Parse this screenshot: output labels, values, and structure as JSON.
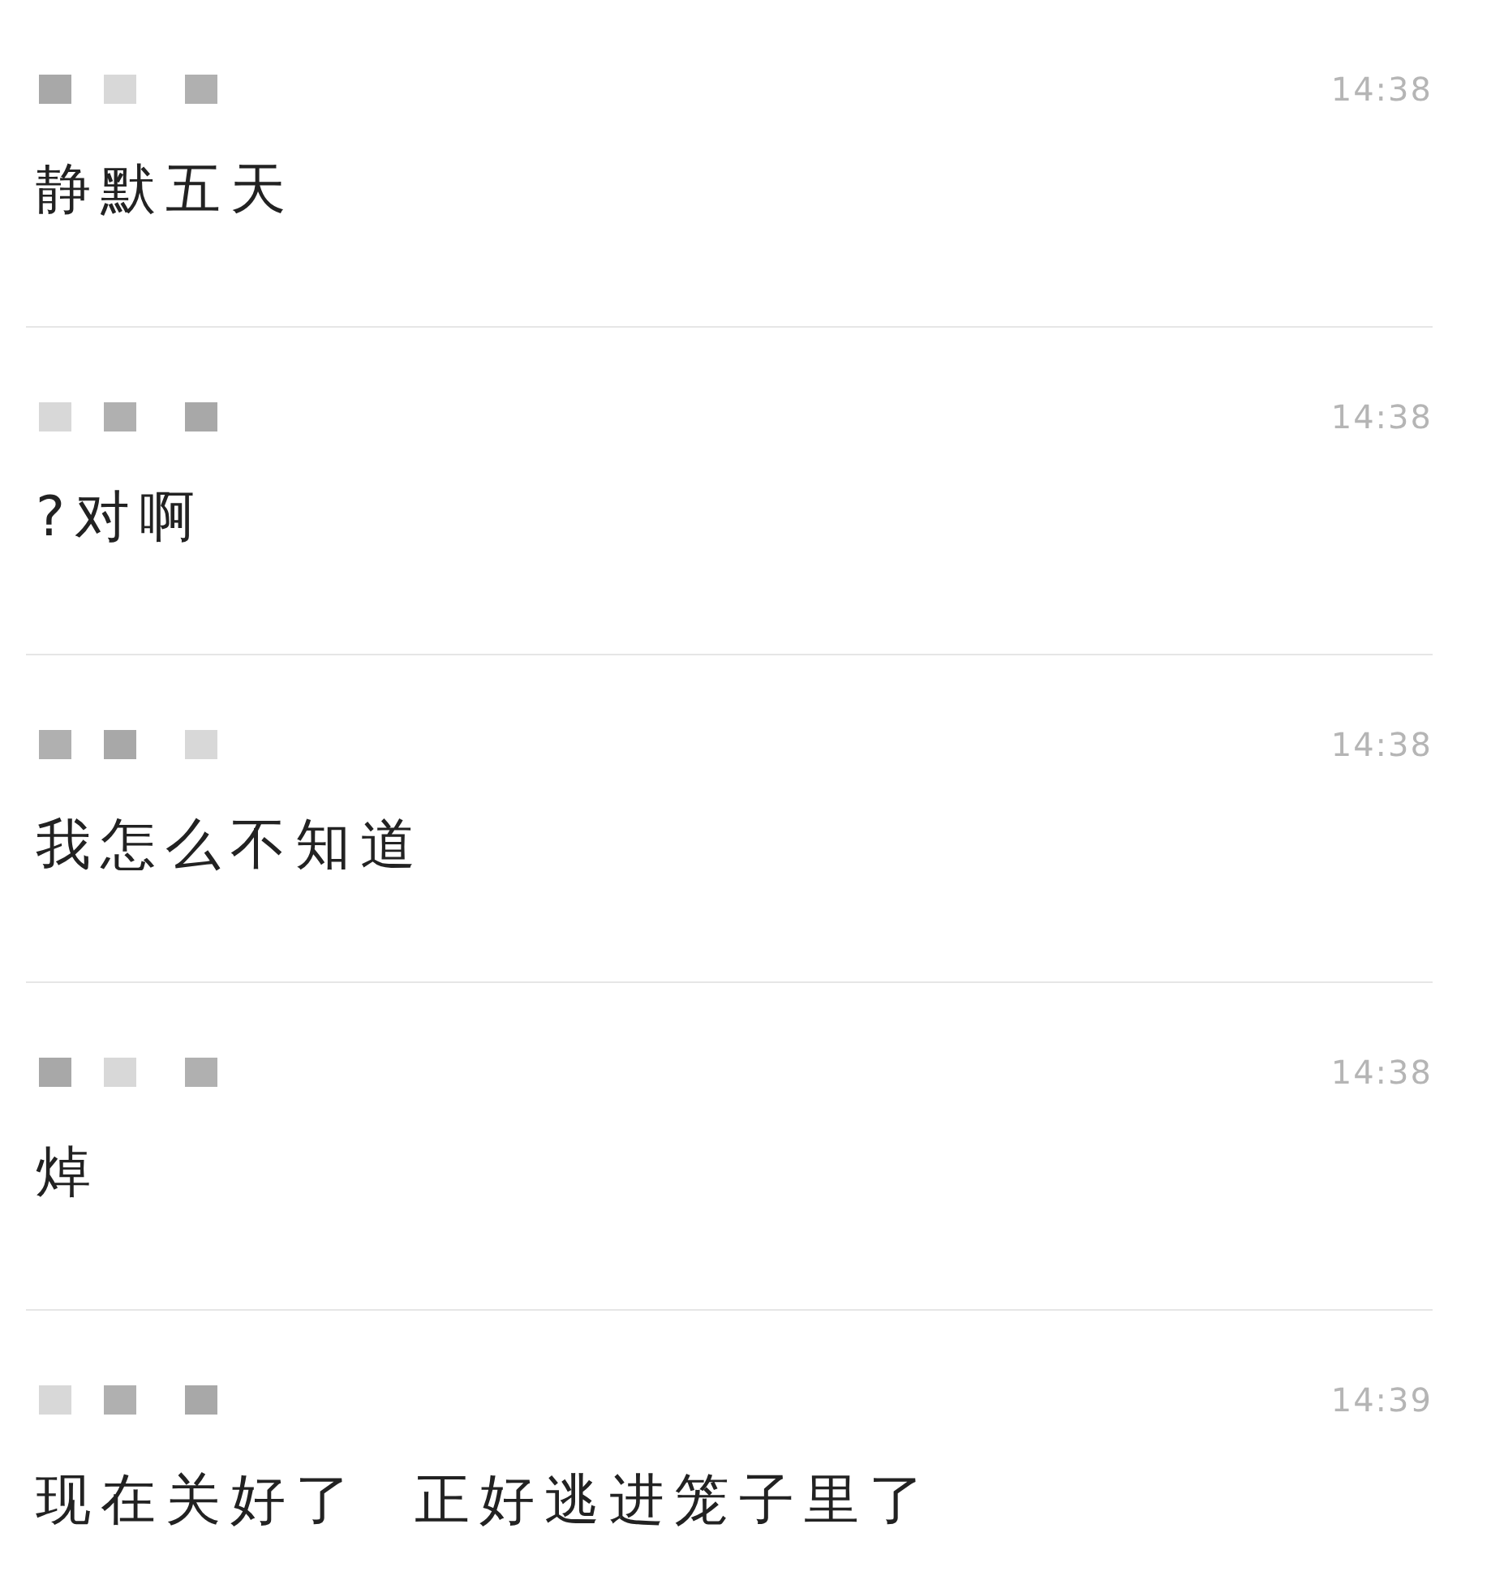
{
  "messages": [
    {
      "name": {
        "kind": "redacted"
      },
      "time": "14:38",
      "text": "静默五天"
    },
    {
      "name": {
        "kind": "redacted"
      },
      "time": "14:38",
      "text": "?对啊"
    },
    {
      "name": {
        "kind": "redacted"
      },
      "time": "14:38",
      "text": "我怎么不知道"
    },
    {
      "name": {
        "kind": "redacted"
      },
      "time": "14:38",
      "text": "焯"
    },
    {
      "name": {
        "kind": "redacted"
      },
      "time": "14:39",
      "text": "现在关好了  正好逃进笼子里了"
    }
  ]
}
